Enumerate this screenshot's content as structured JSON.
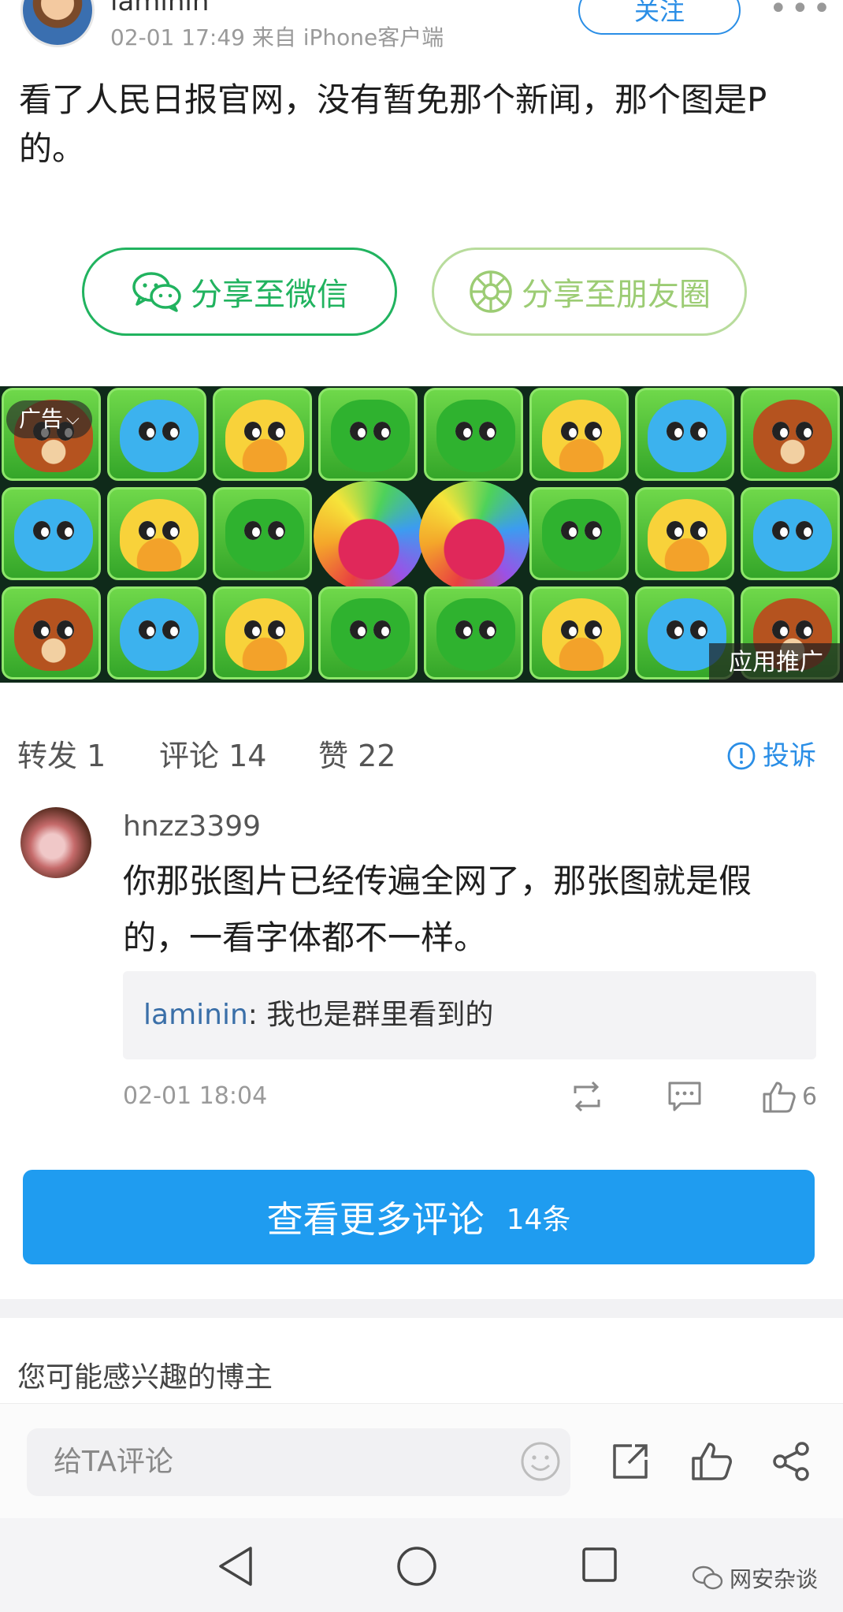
{
  "post": {
    "author": "laminin",
    "meta": "02-01 17:49 来自 iPhone客户端",
    "follow_label": "关注",
    "more_icon": "ellipsis-icon",
    "text": "看了人民日报官网，没有暂免那个新闻，那个图是P的。"
  },
  "share": {
    "wechat_label": "分享至微信",
    "moments_label": "分享至朋友圈",
    "wechat_color": "#21b35f",
    "moments_color": "#9ccc74"
  },
  "ad": {
    "tag": "广告",
    "promo": "应用推广",
    "grid": [
      [
        "bear",
        "blue",
        "chick",
        "frog",
        "frog",
        "chick",
        "blue",
        "bear"
      ],
      [
        "blue",
        "chick",
        "frog",
        "owl",
        "owl",
        "frog",
        "chick",
        "blue"
      ],
      [
        "bear",
        "blue",
        "chick",
        "frog",
        "frog",
        "chick",
        "blue",
        "bear"
      ]
    ]
  },
  "stats": {
    "repost": "转发 1",
    "comments": "评论 14",
    "likes": "赞 22",
    "report": "投诉",
    "accent_color": "#2a8ee6"
  },
  "comment": {
    "user": "hnzz3399",
    "text": "你那张图片已经传遍全网了，那张图就是假的，一看字体都不一样。",
    "reply_user": "laminin",
    "reply_sep": ": ",
    "reply_text": "我也是群里看到的",
    "time": "02-01 18:04",
    "like_count": "6"
  },
  "more_comments": {
    "label": "查看更多评论",
    "count": "14条",
    "color": "#1f9cf0"
  },
  "section_title": "您可能感兴趣的博主",
  "composer": {
    "placeholder": "给TA评论"
  },
  "watermark": "网安杂谈"
}
